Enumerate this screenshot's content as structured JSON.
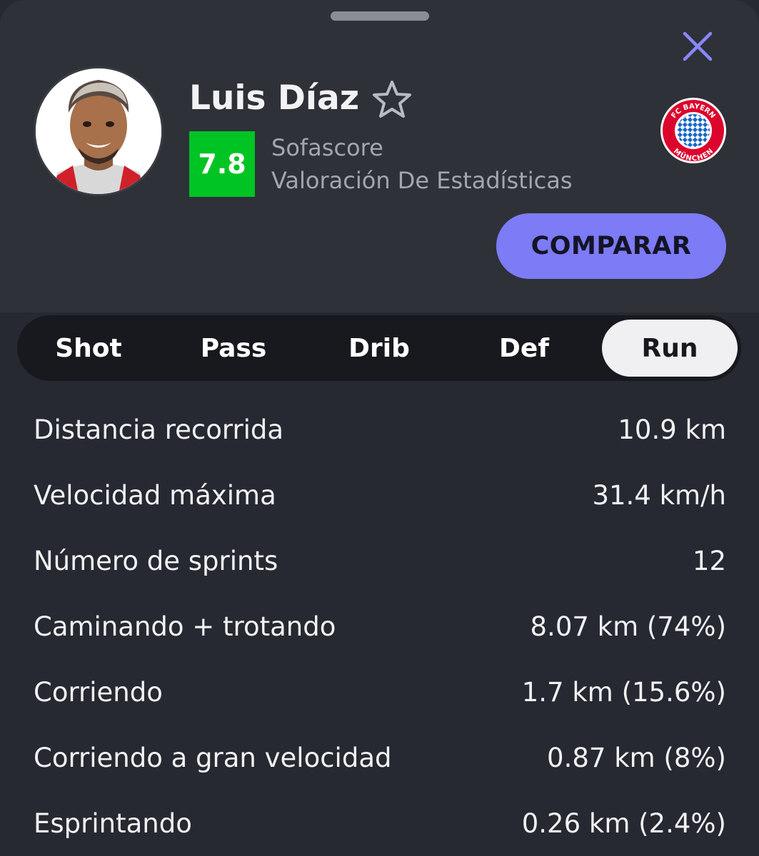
{
  "player": {
    "name": "Luis Díaz",
    "rating": "7.8",
    "rating_source": "Sofascore",
    "rating_label": "Valoración De Estadísticas",
    "club_logo_text_top": "FC BAYERN",
    "club_logo_text_bottom": "MÜNCHEN"
  },
  "actions": {
    "compare_label": "COMPARAR"
  },
  "icons": {
    "close": "close-icon",
    "favorite": "star-outline-icon",
    "club": "fc-bayern-logo"
  },
  "colors": {
    "accent": "#7d7bf5",
    "rating_green": "#00c424",
    "background": "#262931",
    "header_bg": "#2e3138"
  },
  "tabs": [
    {
      "label": "Shot",
      "active": false
    },
    {
      "label": "Pass",
      "active": false
    },
    {
      "label": "Drib",
      "active": false
    },
    {
      "label": "Def",
      "active": false
    },
    {
      "label": "Run",
      "active": true
    }
  ],
  "stats": [
    {
      "label": "Distancia recorrida",
      "value": "10.9 km"
    },
    {
      "label": "Velocidad máxima",
      "value": "31.4 km/h"
    },
    {
      "label": "Número de sprints",
      "value": "12"
    },
    {
      "label": "Caminando + trotando",
      "value": "8.07 km (74%)"
    },
    {
      "label": "Corriendo",
      "value": "1.7 km (15.6%)"
    },
    {
      "label": "Corriendo a gran velocidad",
      "value": "0.87 km (8%)"
    },
    {
      "label": "Esprintando",
      "value": "0.26 km (2.4%)"
    }
  ]
}
